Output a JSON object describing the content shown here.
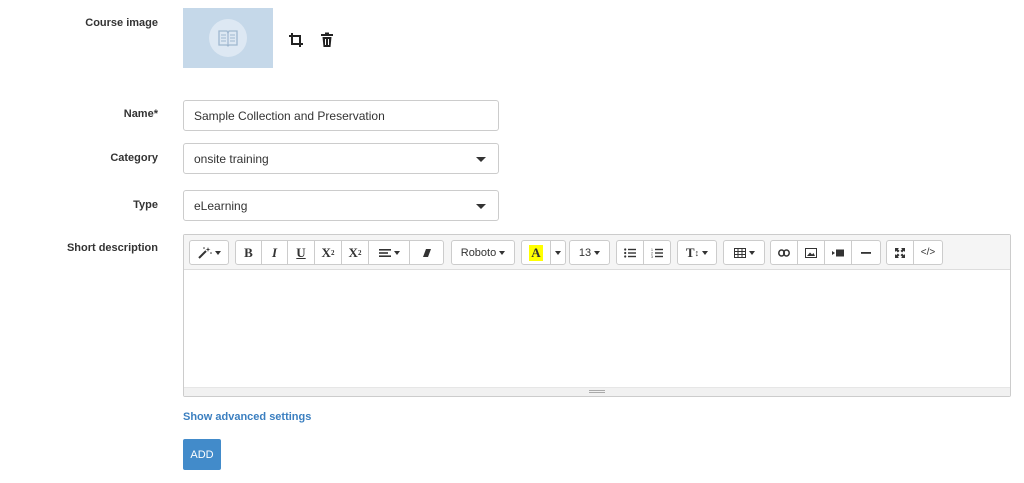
{
  "form": {
    "course_image_label": "Course image",
    "name_label": "Name*",
    "name_value": "Sample Collection and Preservation",
    "category_label": "Category",
    "category_value": "onsite training",
    "type_label": "Type",
    "type_value": "eLearning",
    "short_description_label": "Short description",
    "show_advanced_label": "Show advanced settings",
    "add_label": "ADD"
  },
  "image_tools": {
    "crop_icon": "crop-icon",
    "delete_icon": "trash-icon"
  },
  "editor": {
    "font_family": "Roboto",
    "font_size": "13",
    "icons": [
      "magic-wand-icon",
      "bold-icon",
      "italic-icon",
      "underline-icon",
      "superscript-icon",
      "subscript-icon",
      "align-icon",
      "eraser-icon",
      "font-family-dropdown",
      "text-color-icon",
      "color-dropdown",
      "font-size-dropdown",
      "unordered-list-icon",
      "ordered-list-icon",
      "line-height-icon",
      "table-icon",
      "link-icon",
      "image-icon",
      "video-icon",
      "horizontal-rule-icon",
      "fullscreen-icon",
      "code-view-icon"
    ],
    "text_color_highlight": "#ffff00"
  },
  "colors": {
    "link": "#3b7fc0",
    "primary_button": "#428bca",
    "image_placeholder": "#c5d8e9"
  }
}
